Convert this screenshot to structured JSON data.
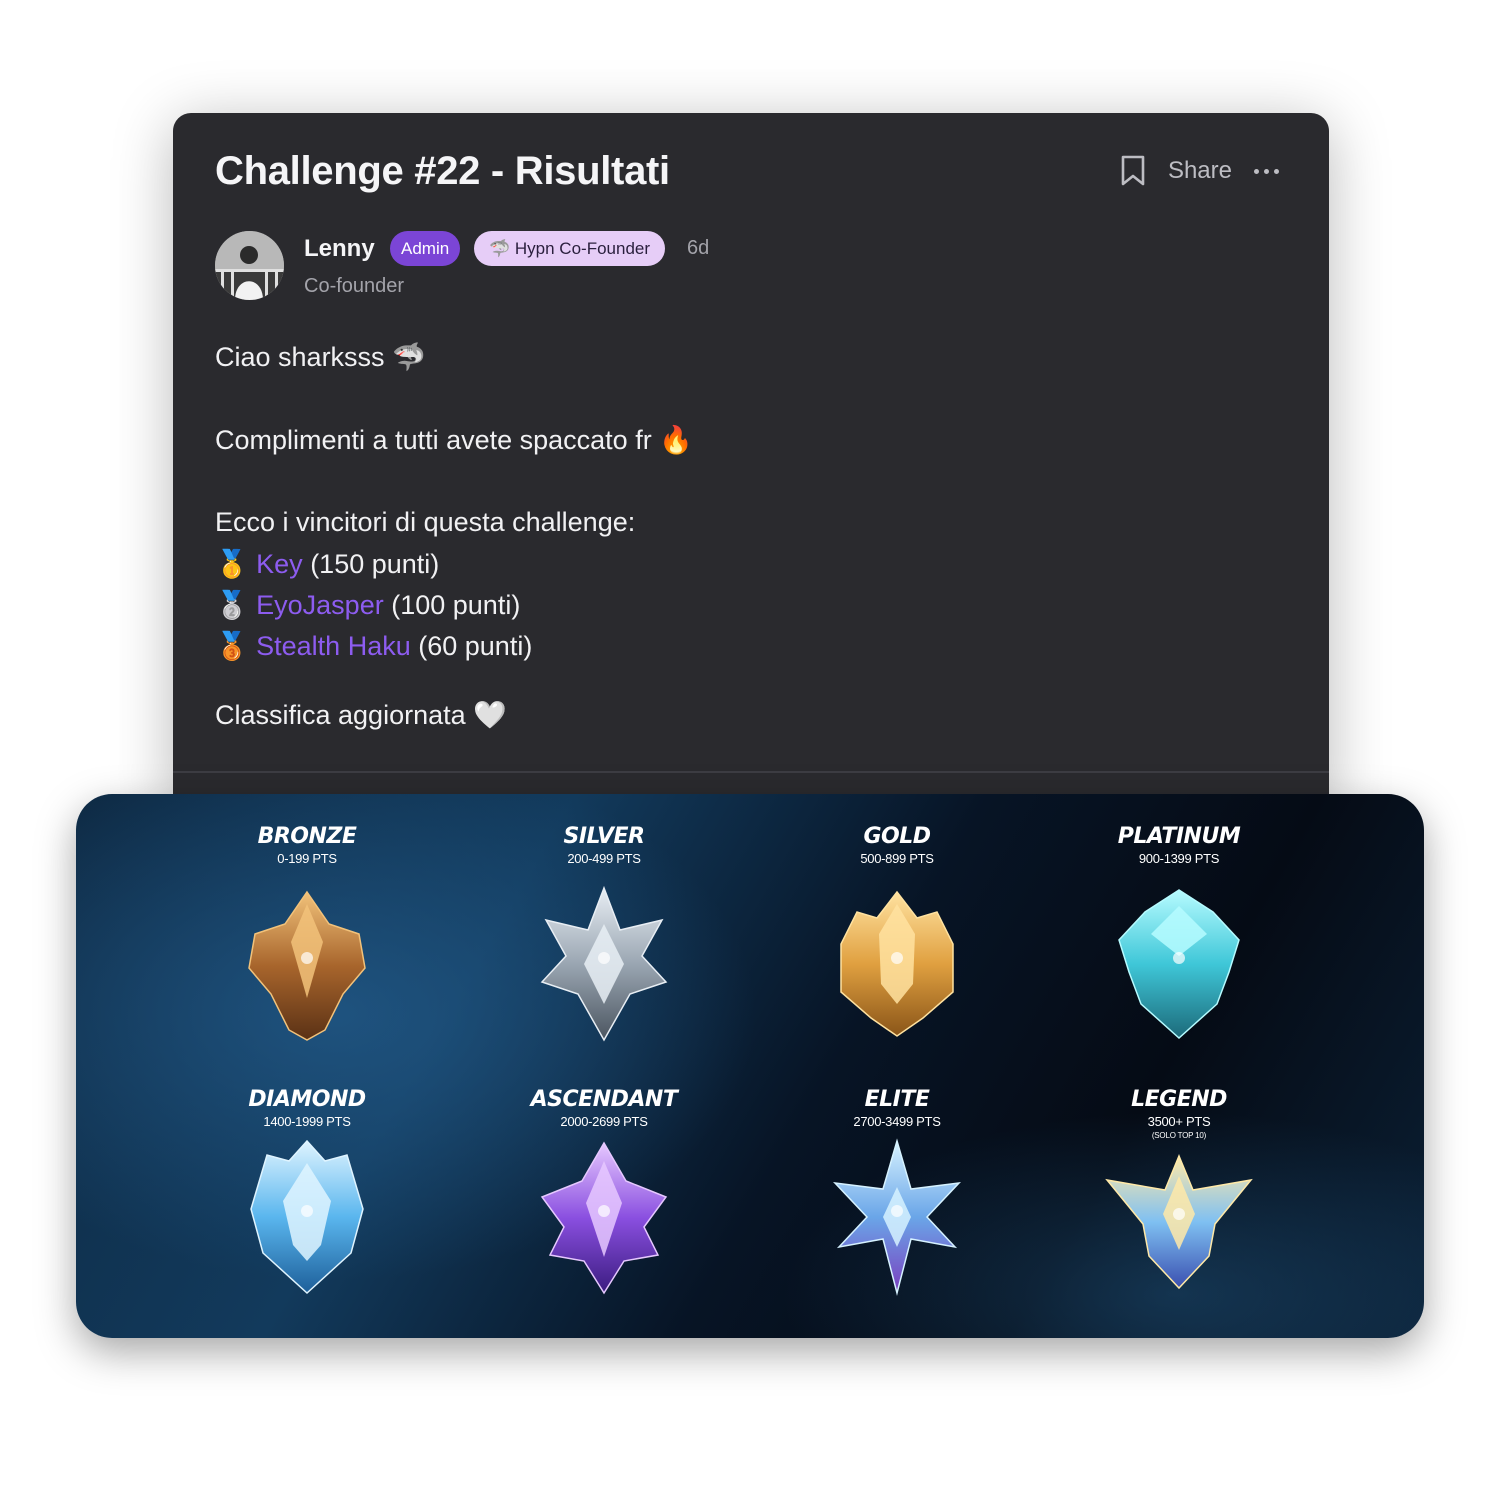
{
  "post": {
    "title": "Challenge #22 - Risultati",
    "actions": {
      "share_label": "Share"
    },
    "author": {
      "name": "Lenny",
      "badges": {
        "admin": "Admin",
        "founder": "🦈 Hypn Co-Founder"
      },
      "age": "6d",
      "role": "Co-founder"
    },
    "body": {
      "greeting": "Ciao sharksss 🦈",
      "compliments": "Complimenti a tutti avete spaccato fr 🔥",
      "winners_intro": "Ecco i vincitori di questa challenge:",
      "winners": [
        {
          "medal": "🥇",
          "name": "Key",
          "points": "(150 punti)"
        },
        {
          "medal": "🥈",
          "name": "EyoJasper",
          "points": "(100 punti)"
        },
        {
          "medal": "🥉",
          "name": "Stealth Haku",
          "points": "(60 punti)"
        }
      ],
      "closing": "Classifica aggiornata 🤍"
    }
  },
  "ranks": [
    {
      "name": "BRONZE",
      "points": "0-199 PTS",
      "colors": [
        "#f2c27a",
        "#a8652c",
        "#5a3115"
      ]
    },
    {
      "name": "SILVER",
      "points": "200-499 PTS",
      "colors": [
        "#e8eef4",
        "#9aa6b2",
        "#4b5560"
      ]
    },
    {
      "name": "GOLD",
      "points": "500-899 PTS",
      "colors": [
        "#ffe2a0",
        "#e0a040",
        "#8a5518"
      ]
    },
    {
      "name": "PLATINUM",
      "points": "900-1399 PTS",
      "colors": [
        "#b6fbff",
        "#3fc7d8",
        "#1c6a7a"
      ]
    },
    {
      "name": "DIAMOND",
      "points": "1400-1999 PTS",
      "colors": [
        "#dff4ff",
        "#5ab6ee",
        "#1d5f9a"
      ]
    },
    {
      "name": "ASCENDANT",
      "points": "2000-2699 PTS",
      "colors": [
        "#e6c8ff",
        "#8a4fe0",
        "#3b1c80"
      ]
    },
    {
      "name": "ELITE",
      "points": "2700-3499 PTS",
      "colors": [
        "#d6f2ff",
        "#6aa6e8",
        "#7a3fbf"
      ]
    },
    {
      "name": "LEGEND",
      "points": "3500+ PTS",
      "note": "(SOLO TOP 10)",
      "colors": [
        "#ffe9a8",
        "#7fc0f2",
        "#3a4fb0"
      ]
    }
  ]
}
